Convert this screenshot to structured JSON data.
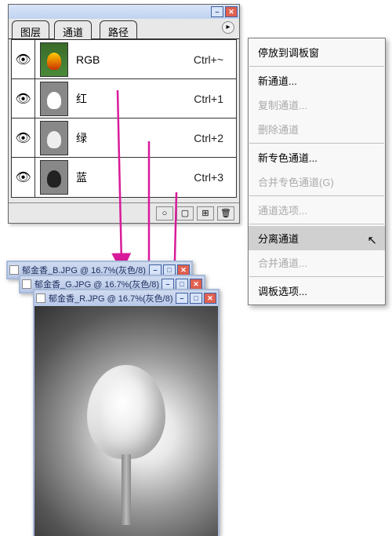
{
  "panel": {
    "tabs": {
      "layers": "图层",
      "channels": "通道",
      "paths": "路径"
    },
    "channels": [
      {
        "name": "RGB",
        "shortcut": "Ctrl+~"
      },
      {
        "name": "红",
        "shortcut": "Ctrl+1"
      },
      {
        "name": "绿",
        "shortcut": "Ctrl+2"
      },
      {
        "name": "蓝",
        "shortcut": "Ctrl+3"
      }
    ]
  },
  "menu": {
    "dock_to_palette": "停放到调板窗",
    "new_channel": "新通道...",
    "dup_channel": "复制通道...",
    "del_channel": "删除通道",
    "new_spot": "新专色通道...",
    "merge_spot": "合并专色通道(G)",
    "channel_options": "通道选项...",
    "split_channels": "分离通道",
    "merge_channels": "合并通道...",
    "palette_options": "调板选项..."
  },
  "windows": [
    {
      "title": "郁金香_B.JPG @ 16.7%(灰色/8)"
    },
    {
      "title": "郁金香_G.JPG @ 16.7%(灰色/8)"
    },
    {
      "title": "郁金香_R.JPG @ 16.7%(灰色/8)"
    }
  ],
  "icons": {
    "minimize": "–",
    "close": "✕",
    "maximize": "□",
    "menu_arrow": "▸",
    "eye": "👁",
    "footer_circle": "○",
    "footer_mask": "▢",
    "footer_new": "⊞",
    "footer_trash": "🗑"
  },
  "annotation_color": "#d81b9a"
}
